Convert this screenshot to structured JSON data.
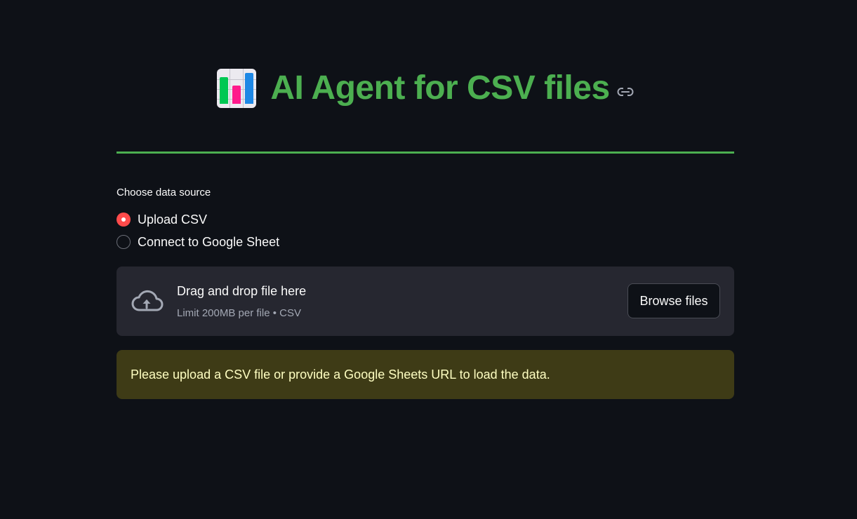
{
  "header": {
    "title": "AI Agent for CSV files",
    "emoji_icon": "bar-chart-emoji",
    "anchor_icon": "link-icon",
    "accent_color": "#4caf50"
  },
  "data_source": {
    "label": "Choose data source",
    "options": [
      {
        "label": "Upload CSV",
        "selected": true
      },
      {
        "label": "Connect to Google Sheet",
        "selected": false
      }
    ],
    "selected_color": "#ff4b4b"
  },
  "uploader": {
    "icon": "cloud-upload-icon",
    "main_text": "Drag and drop file here",
    "sub_text": "Limit 200MB per file • CSV",
    "button_label": "Browse files"
  },
  "alert": {
    "text": "Please upload a CSV file or provide a Google Sheets URL to load the data."
  }
}
